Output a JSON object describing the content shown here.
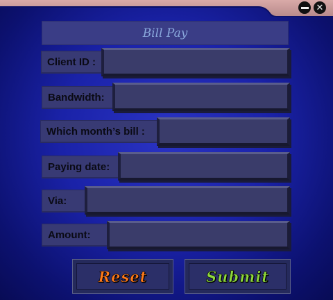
{
  "window": {
    "minimize_icon": "minimize-icon",
    "close_icon": "close-icon",
    "titlebar_color": "#c79a9a"
  },
  "form": {
    "title": "Bill Pay",
    "fields": [
      {
        "label": "Client ID :",
        "value": ""
      },
      {
        "label": "Bandwidth:",
        "value": ""
      },
      {
        "label": "Which month’s bill  :",
        "value": ""
      },
      {
        "label": "Paying date:",
        "value": ""
      },
      {
        "label": "Via:",
        "value": ""
      },
      {
        "label": "Amount:",
        "value": ""
      }
    ]
  },
  "actions": {
    "reset_label": "Reset",
    "submit_label": "Submit",
    "reset_color": "#ff7a1a",
    "submit_color": "#8ed93a"
  }
}
